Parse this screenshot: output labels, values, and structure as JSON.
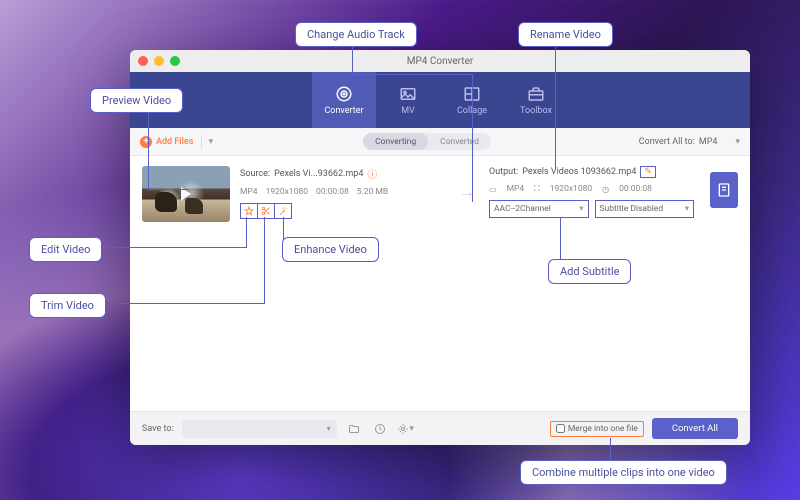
{
  "window": {
    "title": "MP4 Converter"
  },
  "nav": {
    "items": [
      {
        "label": "Converter"
      },
      {
        "label": "MV"
      },
      {
        "label": "Collage"
      },
      {
        "label": "Toolbox"
      }
    ]
  },
  "toolbar": {
    "add_files": "Add Files",
    "tabs": {
      "converting": "Converting",
      "converted": "Converted"
    },
    "convert_all_to": "Convert All to:",
    "format": "MP4"
  },
  "item": {
    "source_label": "Source:",
    "source_file": "Pexels Vi...93662.mp4",
    "format": "MP4",
    "resolution": "1920x1080",
    "duration": "00:00:08",
    "size": "5.20 MB",
    "output_label": "Output:",
    "output_file": "Pexels Videos 1093662.mp4",
    "out_format": "MP4",
    "out_resolution": "1920x1080",
    "out_duration": "00:00:08",
    "audio_select": "AAC--2Channel",
    "subtitle_select": "Subtitle Disabled"
  },
  "footer": {
    "save_to": "Save to:",
    "merge": "Merge into one file",
    "convert": "Convert All"
  },
  "callouts": {
    "preview": "Preview Video",
    "change_audio": "Change Audio Track",
    "rename": "Rename Video",
    "edit": "Edit Video",
    "trim": "Trim Video",
    "enhance": "Enhance Video",
    "add_subtitle": "Add Subtitle",
    "combine": "Combine multiple clips into one video"
  },
  "colors": {
    "accent": "#5a62c9",
    "orange": "#ff7a3d"
  }
}
